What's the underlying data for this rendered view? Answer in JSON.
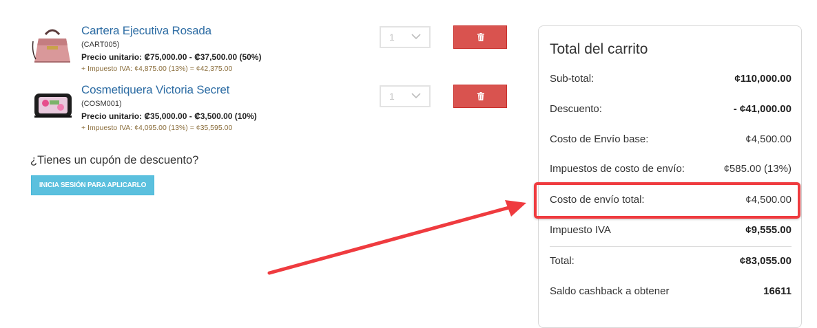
{
  "items": [
    {
      "name": "Cartera Ejecutiva Rosada",
      "code": "(CART005)",
      "price": "Precio unitario: ₡75,000.00 - ₡37,500.00 (50%)",
      "tax": "+ Impuesto IVA: ¢4,875.00 (13%) = ¢42,375.00",
      "quantity": "1"
    },
    {
      "name": "Cosmetiquera Victoria Secret",
      "code": "(COSM001)",
      "price": "Precio unitario: ₡35,000.00 - ₡3,500.00 (10%)",
      "tax": "+ Impuesto IVA: ¢4,095.00 (13%) = ¢35,595.00",
      "quantity": "1"
    }
  ],
  "coupon": {
    "question": "¿Tienes un cupón de descuento?",
    "button_label": "INICIA SESIÓN PARA APLICARLO"
  },
  "cart_total": {
    "title": "Total del carrito",
    "rows": [
      {
        "label": "Sub-total:",
        "value": "¢110,000.00"
      },
      {
        "label": "Descuento:",
        "value": "- ¢41,000.00"
      },
      {
        "label": "Costo de Envío base:",
        "value": "¢4,500.00"
      },
      {
        "label": "Impuestos de costo de envío:",
        "value": "¢585.00 (13%)"
      },
      {
        "label": "Costo de envío total:",
        "value": "¢4,500.00"
      },
      {
        "label": "Impuesto IVA",
        "value": "¢9,555.00"
      },
      {
        "label": "Total:",
        "value": "¢83,055.00"
      },
      {
        "label": "Saldo cashback a obtener",
        "value": "16611"
      }
    ]
  },
  "colors": {
    "link": "#2e6da4",
    "delete_button": "#d9534f",
    "coupon_button": "#5bc0de",
    "annotation": "#ef3b3f"
  },
  "icons": {
    "delete": "trash-icon",
    "quantity_dropdown": "chevron-down-icon"
  }
}
